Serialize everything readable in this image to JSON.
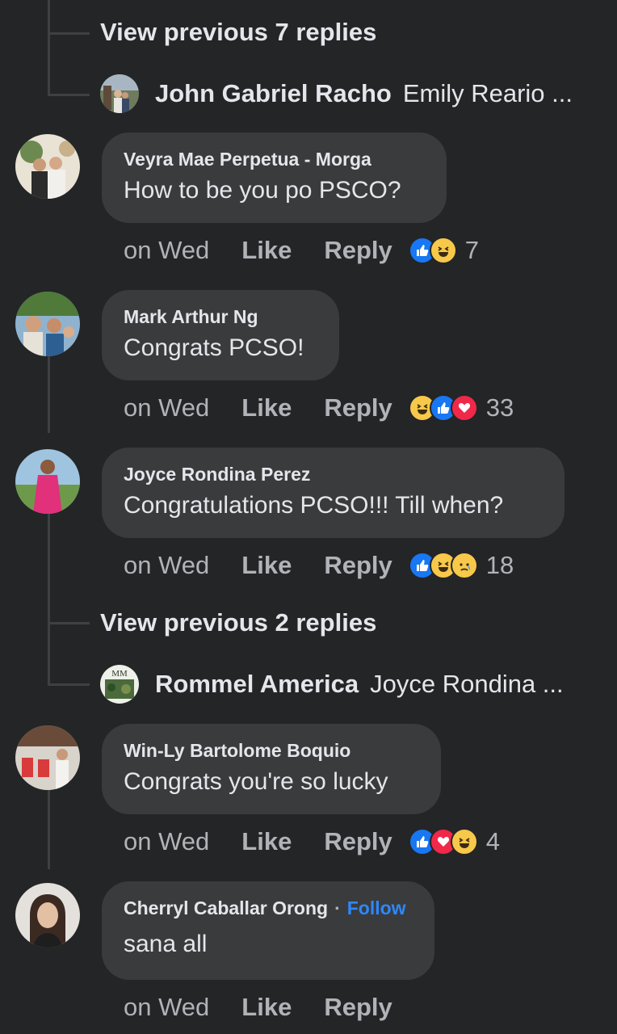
{
  "thread1": {
    "view_previous": "View previous 7 replies",
    "reply_name": "John Gabriel Racho",
    "reply_preview": "Emily Reario ..."
  },
  "comments": [
    {
      "name": "Veyra Mae Perpetua - Morga",
      "text": "How to be you po PSCO?",
      "time": "on Wed",
      "like": "Like",
      "reply": "Reply",
      "reactions": [
        "like",
        "haha"
      ],
      "count": "7"
    },
    {
      "name": "Mark Arthur Ng",
      "text": "Congrats PCSO!",
      "time": "on Wed",
      "like": "Like",
      "reply": "Reply",
      "reactions": [
        "haha",
        "like",
        "love"
      ],
      "count": "33"
    },
    {
      "name": "Joyce Rondina Perez",
      "text": "Congratulations PCSO!!! Till when?",
      "time": "on Wed",
      "like": "Like",
      "reply": "Reply",
      "reactions": [
        "like",
        "haha",
        "sad"
      ],
      "count": "18"
    },
    {
      "name": "Win-Ly Bartolome Boquio",
      "text": "Congrats you're so lucky",
      "time": "on Wed",
      "like": "Like",
      "reply": "Reply",
      "reactions": [
        "like",
        "love",
        "haha"
      ],
      "count": "4"
    },
    {
      "name": "Cherryl Caballar Orong",
      "separator": "·",
      "follow": "Follow",
      "text": "sana all",
      "time": "on Wed",
      "like": "Like",
      "reply": "Reply"
    }
  ],
  "thread2": {
    "view_previous": "View previous 2 replies",
    "reply_name": "Rommel America",
    "reply_preview": "Joyce Rondina ..."
  },
  "colors": {
    "background": "#242526",
    "bubble": "#3a3b3c",
    "text": "#e4e6eb",
    "secondary": "#b0b3b8",
    "link": "#2d88ff",
    "like": "#1877f2",
    "love": "#f0284a",
    "haha": "#f7c84a"
  }
}
